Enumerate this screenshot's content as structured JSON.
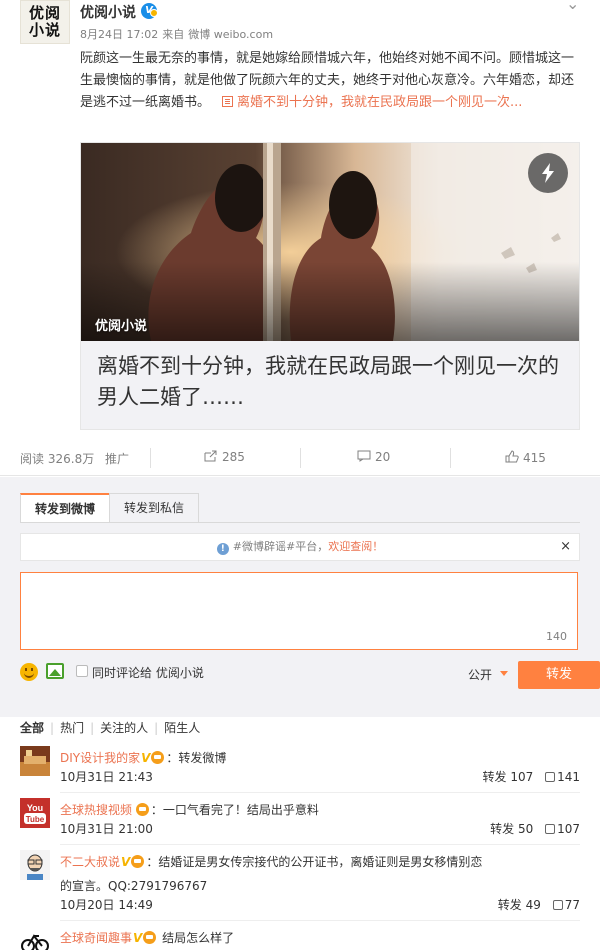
{
  "post": {
    "author": "优阅小说",
    "avatar_text_top": "优阅",
    "avatar_text_bottom": "小说",
    "verified_badge": "V",
    "date": "8月24日 17:02",
    "source_prefix": "来自",
    "source": "微博 weibo.com",
    "text": "阮颜这一生最无奈的事情，就是她嫁给顾惜城六年，他始终对她不闻不问。顾惜城这一生最懊恼的事情，就是他做了阮颜六年的丈夫，她终于对他心灰意冷。六年婚恋，却还是逃不过一纸离婚书。",
    "link_text": "离婚不到十分钟，我就在民政局跟一个刚见一次...",
    "more_icon": "chevron-down-icon"
  },
  "card": {
    "brand": "优阅小说",
    "title": "离婚不到十分钟，我就在民政局跟一个刚见一次的男人二婚了……",
    "flash_icon": "lightning-icon"
  },
  "stats": {
    "reads_label": "阅读",
    "reads": "326.8万",
    "promote": "推广",
    "forwards": "285",
    "comments": "20",
    "likes": "415"
  },
  "forward_panel": {
    "tab_weibo": "转发到微博",
    "tab_private": "转发到私信",
    "notice_prefix": "#微博辟谣#平台，",
    "notice_highlight": "欢迎查阅！",
    "notice_close": "×",
    "counter": "140",
    "also_comment": "同时评论给 优阅小说",
    "visibility": "公开",
    "forward_button": "转发"
  },
  "comment_filters": [
    "全部",
    "热门",
    "关注的人",
    "陌生人"
  ],
  "comments": [
    {
      "name": "DIY设计我的家",
      "text": "：转发微博",
      "time": "10月31日 21:43",
      "forward_label": "转发",
      "forwards": "107",
      "likes": "141"
    },
    {
      "name": "全球热搜视频",
      "text": "：一口气看完了！结局出乎意料",
      "time": "10月31日 21:00",
      "forward_label": "转发",
      "forwards": "50",
      "likes": "107"
    },
    {
      "name": "不二大叔说",
      "text": "：结婚证是男女传宗接代的公开证书，离婚证则是男女移情别恋的宣言。QQ:2791796767",
      "time": "10月20日 14:49",
      "forward_label": "转发",
      "forwards": "49",
      "likes": "77"
    },
    {
      "name": "全球奇闻趣事",
      "text": " 结局怎么样了"
    }
  ],
  "colors": {
    "accent": "#ff8140",
    "link": "#eb7350",
    "verified": "#1a8ee8"
  }
}
